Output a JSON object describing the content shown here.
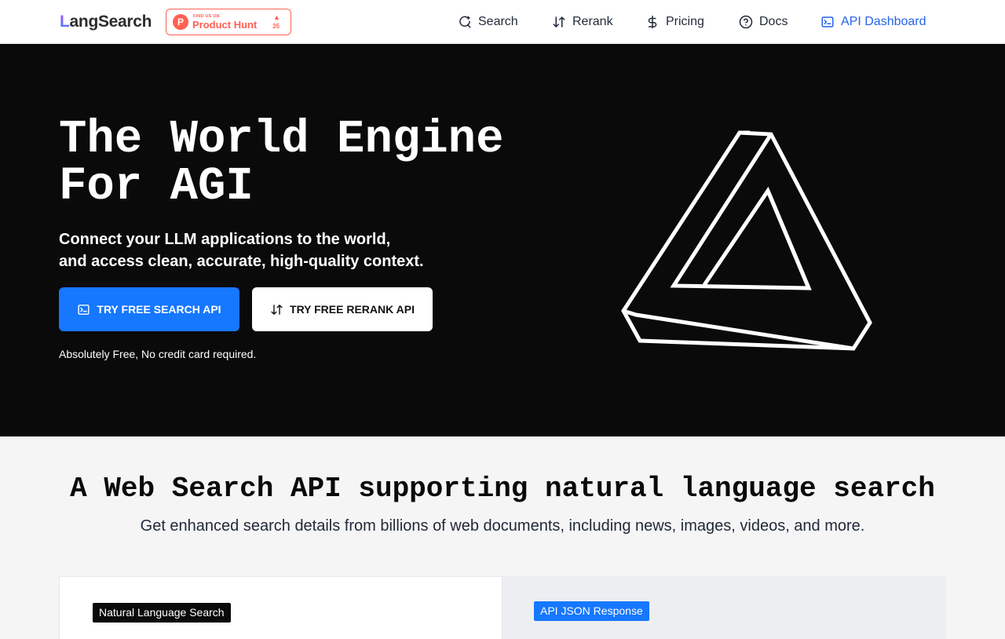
{
  "nav": {
    "logo_first": "L",
    "logo_rest": "angSearch",
    "product_hunt": {
      "small": "FIND US ON",
      "name": "Product Hunt",
      "arrow": "▲",
      "count": "35"
    },
    "items": [
      {
        "label": "Search",
        "icon": "search-icon"
      },
      {
        "label": "Rerank",
        "icon": "sort-icon"
      },
      {
        "label": "Pricing",
        "icon": "dollar-icon"
      },
      {
        "label": "Docs",
        "icon": "help-circle-icon"
      },
      {
        "label": "API Dashboard",
        "icon": "terminal-icon",
        "active": true
      }
    ]
  },
  "hero": {
    "title_line1": "The World Engine",
    "title_line2": "For AGI",
    "sub_line1": "Connect your LLM applications to the world,",
    "sub_line2": "and access clean, accurate, high-quality context.",
    "btn_primary": "TRY FREE SEARCH API",
    "btn_secondary": "TRY FREE RERANK API",
    "note": "Absolutely Free, No credit card required."
  },
  "section": {
    "title": "A Web Search API supporting natural language search",
    "subtitle": "Get enhanced search details from billions of web documents, including news, images, videos, and more.",
    "left_tag": "Natural Language Search",
    "right_tag": "API JSON Response"
  },
  "colors": {
    "accent": "#1677ff",
    "active_nav": "#2563eb",
    "hero_bg": "#0a0a0a",
    "product_hunt": "#ff6154"
  }
}
